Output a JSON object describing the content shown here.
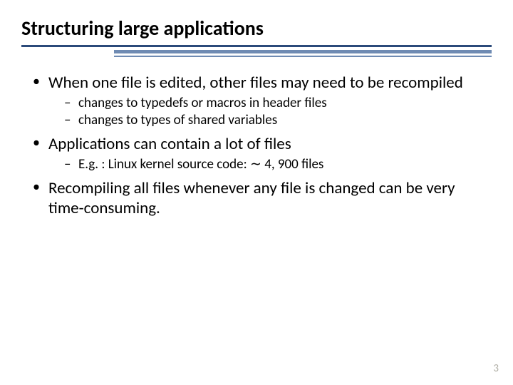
{
  "title": "Structuring large applications",
  "bullets": {
    "b1": "When one file is edited, other files may need to be recompiled",
    "b1_sub1": "changes to typedefs or macros in header files",
    "b1_sub2": "changes to types of shared variables",
    "b2": "Applications can contain a lot of files",
    "b2_sub1": "E.g. : Linux kernel source code: ∼ 4, 900 files",
    "b3": "Recompiling all files whenever any file is changed can be very time-consuming."
  },
  "page_number": "3"
}
